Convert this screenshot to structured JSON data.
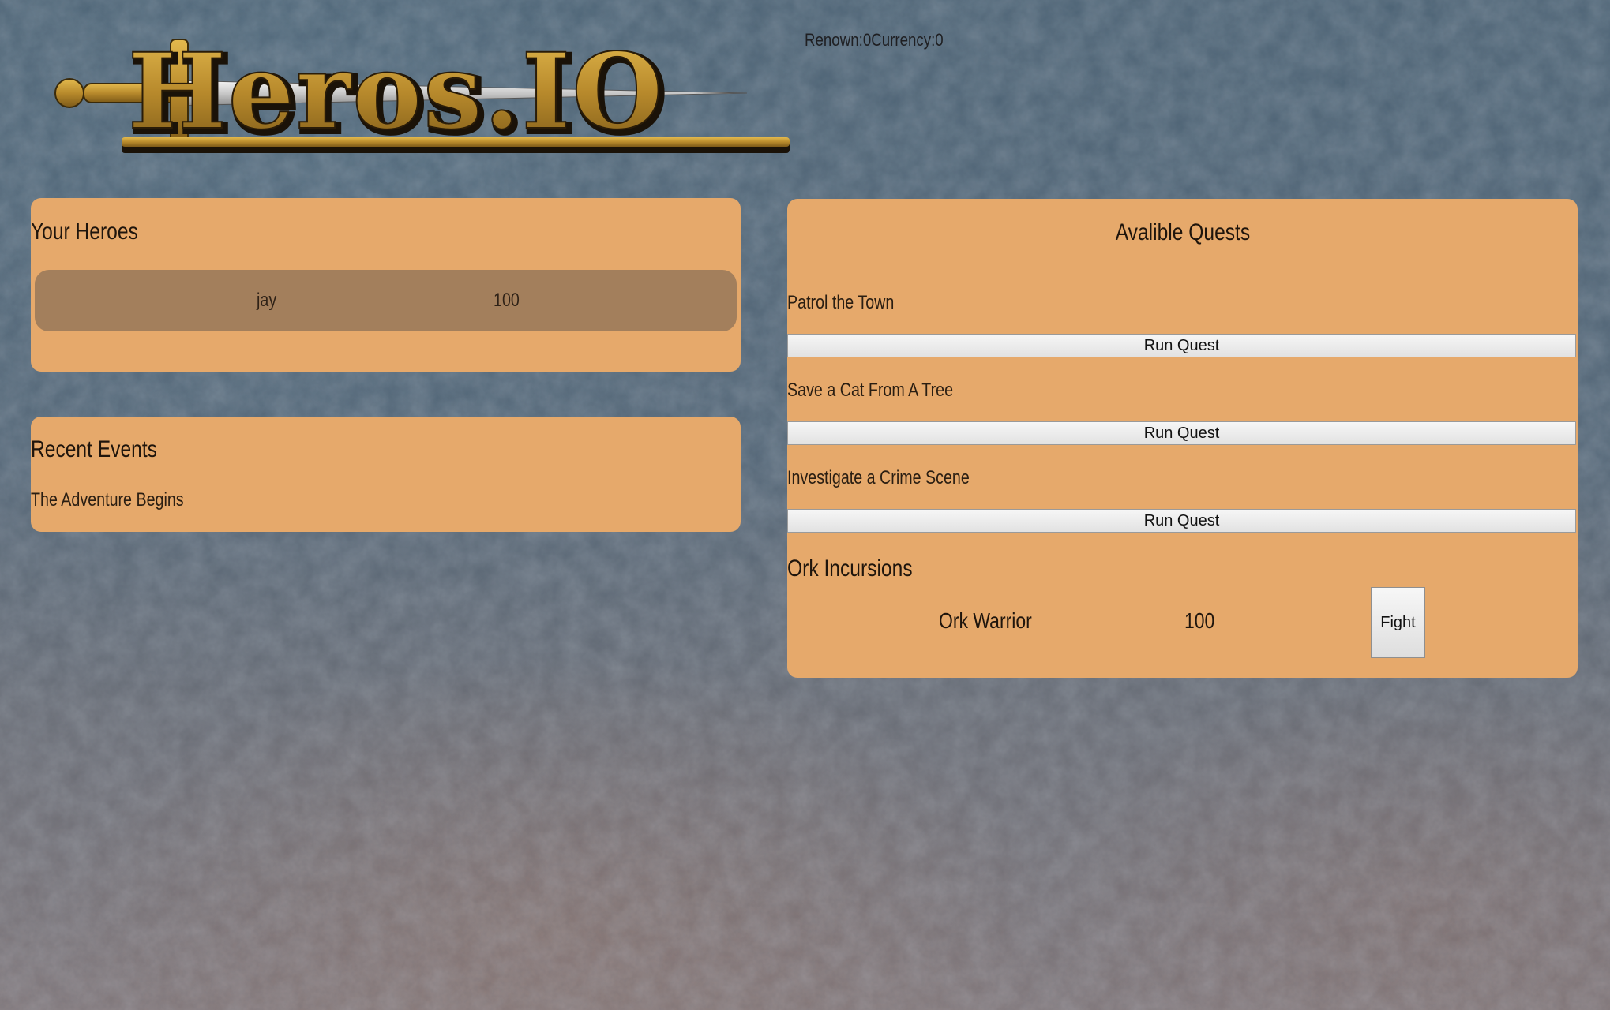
{
  "logo": {
    "text": "Heros.IO"
  },
  "stats": {
    "renown_label": "Renown:",
    "renown_value": "0",
    "currency_label": "Currency:",
    "currency_value": "0"
  },
  "heroes": {
    "title": "Your Heroes",
    "list": [
      {
        "name": "jay",
        "health": "100"
      }
    ]
  },
  "events": {
    "title": "Recent Events",
    "items": [
      "The Adventure Begins"
    ]
  },
  "quests": {
    "title": "Avalible Quests",
    "list": [
      {
        "name": "Patrol the Town",
        "button_label": "Run Quest"
      },
      {
        "name": "Save a Cat From A Tree",
        "button_label": "Run Quest"
      },
      {
        "name": "Investigate a Crime Scene",
        "button_label": "Run Quest"
      }
    ]
  },
  "ork": {
    "title": "Ork Incursions",
    "enemy_name": "Ork Warrior",
    "enemy_health": "100",
    "fight_label": "Fight"
  },
  "colors": {
    "panel": "#e6a96b",
    "hero_row": "#a37f5c",
    "logo_gold": "#b88a2c",
    "background": "#56697a"
  }
}
